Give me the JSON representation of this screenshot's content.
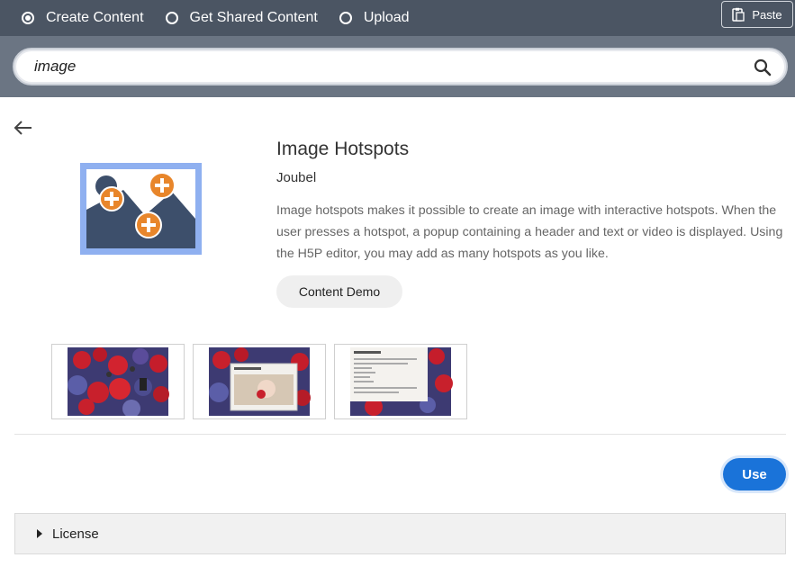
{
  "topbar": {
    "options": [
      {
        "label": "Create Content",
        "checked": true
      },
      {
        "label": "Get Shared Content",
        "checked": false
      },
      {
        "label": "Upload",
        "checked": false
      }
    ],
    "paste_label": "Paste"
  },
  "search": {
    "value": "image",
    "icon": "search-icon"
  },
  "content": {
    "title": "Image Hotspots",
    "author": "Joubel",
    "description": "Image hotspots makes it possible to create an image with interactive hotspots. When the user presses a hotspot, a popup containing a header and text or video is displayed. Using the H5P editor, you may add as many hotspots as you like.",
    "demo_label": "Content Demo",
    "use_label": "Use",
    "license_label": "License"
  },
  "colors": {
    "topbar": "#4b5563",
    "accent": "#1a73d9",
    "icon_bg": "#8fb0f0",
    "icon_mountain": "#3d4f6b",
    "icon_hotspot": "#e8862b"
  }
}
